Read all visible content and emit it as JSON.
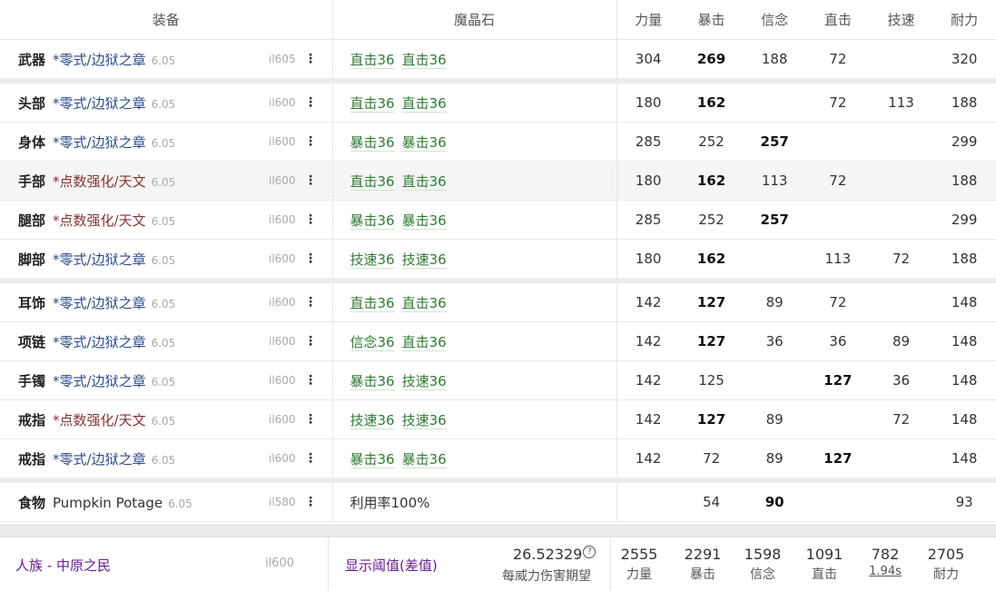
{
  "headers": {
    "equipment": "装备",
    "materia": "魔晶石",
    "stats": [
      "力量",
      "暴击",
      "信念",
      "直击",
      "技速",
      "耐力"
    ]
  },
  "rows": [
    {
      "slot": "武器",
      "name": "*零式/边狱之章",
      "kind": "tome",
      "ver": "6.05",
      "il": "il605",
      "materia": [
        "直击36",
        "直击36"
      ],
      "stats": [
        "304",
        "269",
        "188",
        "72",
        "",
        "320"
      ],
      "bold": [
        1
      ],
      "sep": false,
      "hl": false
    },
    {
      "slot": "头部",
      "name": "*零式/边狱之章",
      "kind": "tome",
      "ver": "6.05",
      "il": "il600",
      "materia": [
        "直击36",
        "直击36"
      ],
      "stats": [
        "180",
        "162",
        "",
        "72",
        "113",
        "188"
      ],
      "bold": [
        1
      ],
      "sep": true,
      "hl": false
    },
    {
      "slot": "身体",
      "name": "*零式/边狱之章",
      "kind": "tome",
      "ver": "6.05",
      "il": "il600",
      "materia": [
        "暴击36",
        "暴击36"
      ],
      "stats": [
        "285",
        "252",
        "257",
        "",
        "",
        "299"
      ],
      "bold": [
        2
      ],
      "sep": false,
      "hl": false
    },
    {
      "slot": "手部",
      "name": "*点数强化/天文",
      "kind": "raid",
      "ver": "6.05",
      "il": "il600",
      "materia": [
        "直击36",
        "直击36"
      ],
      "stats": [
        "180",
        "162",
        "113",
        "72",
        "",
        "188"
      ],
      "bold": [
        1
      ],
      "sep": false,
      "hl": true
    },
    {
      "slot": "腿部",
      "name": "*点数强化/天文",
      "kind": "raid",
      "ver": "6.05",
      "il": "il600",
      "materia": [
        "暴击36",
        "暴击36"
      ],
      "stats": [
        "285",
        "252",
        "257",
        "",
        "",
        "299"
      ],
      "bold": [
        2
      ],
      "sep": false,
      "hl": false
    },
    {
      "slot": "脚部",
      "name": "*零式/边狱之章",
      "kind": "tome",
      "ver": "6.05",
      "il": "il600",
      "materia": [
        "技速36",
        "技速36"
      ],
      "stats": [
        "180",
        "162",
        "",
        "113",
        "72",
        "188"
      ],
      "bold": [
        1
      ],
      "sep": false,
      "hl": false
    },
    {
      "slot": "耳饰",
      "name": "*零式/边狱之章",
      "kind": "tome",
      "ver": "6.05",
      "il": "il600",
      "materia": [
        "直击36",
        "直击36"
      ],
      "stats": [
        "142",
        "127",
        "89",
        "72",
        "",
        "148"
      ],
      "bold": [
        1
      ],
      "sep": true,
      "hl": false
    },
    {
      "slot": "项链",
      "name": "*零式/边狱之章",
      "kind": "tome",
      "ver": "6.05",
      "il": "il600",
      "materia": [
        "信念36",
        "直击36"
      ],
      "stats": [
        "142",
        "127",
        "36",
        "36",
        "89",
        "148"
      ],
      "bold": [
        1
      ],
      "sep": false,
      "hl": false
    },
    {
      "slot": "手镯",
      "name": "*零式/边狱之章",
      "kind": "tome",
      "ver": "6.05",
      "il": "il600",
      "materia": [
        "暴击36",
        "技速36"
      ],
      "stats": [
        "142",
        "125",
        "",
        "127",
        "36",
        "148"
      ],
      "bold": [
        3
      ],
      "sep": false,
      "hl": false
    },
    {
      "slot": "戒指",
      "name": "*点数强化/天文",
      "kind": "raid",
      "ver": "6.05",
      "il": "il600",
      "materia": [
        "技速36",
        "技速36"
      ],
      "stats": [
        "142",
        "127",
        "89",
        "",
        "72",
        "148"
      ],
      "bold": [
        1
      ],
      "sep": false,
      "hl": false
    },
    {
      "slot": "戒指",
      "name": "*零式/边狱之章",
      "kind": "tome",
      "ver": "6.05",
      "il": "il600",
      "materia": [
        "暴击36",
        "暴击36"
      ],
      "stats": [
        "142",
        "72",
        "89",
        "127",
        "",
        "148"
      ],
      "bold": [
        3
      ],
      "sep": false,
      "hl": false
    },
    {
      "slot": "食物",
      "name": "Pumpkin Potage",
      "kind": "food",
      "ver": "6.05",
      "il": "il580",
      "materia": [
        "利用率100%"
      ],
      "materia_plain": true,
      "stats": [
        "",
        "54",
        "90",
        "",
        "",
        "93"
      ],
      "bold": [
        2
      ],
      "sep": true,
      "hl": false
    }
  ],
  "footer": {
    "race": "人族 - 中原之民",
    "il": "il600",
    "threshold_label": "显示阈值(差值)",
    "damage_value": "26.52329",
    "damage_help": "?",
    "damage_label": "每威力伤害期望",
    "totals": [
      {
        "value": "2555",
        "label": "力量",
        "underline": false
      },
      {
        "value": "2291",
        "label": "暴击",
        "underline": false
      },
      {
        "value": "1598",
        "label": "信念",
        "underline": false
      },
      {
        "value": "1091",
        "label": "直击",
        "underline": false
      },
      {
        "value": "782",
        "label": "1.94s",
        "underline": true
      },
      {
        "value": "2705",
        "label": "耐力",
        "underline": false
      }
    ]
  },
  "colors": {
    "tome": "#2a4c8a",
    "raid": "#8a3030",
    "materia": "#2e7d32",
    "link": "#6a1b9a"
  }
}
